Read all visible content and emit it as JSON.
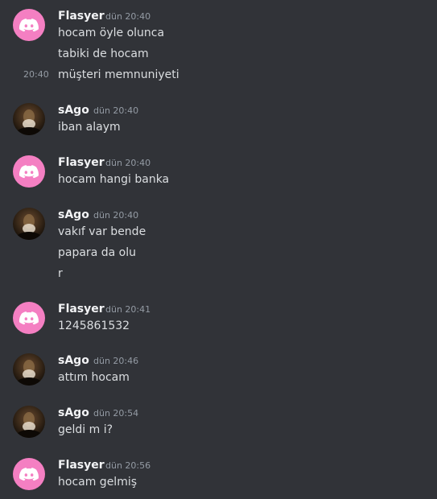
{
  "messages": [
    {
      "author": "Flasyer",
      "time": "dün 20:40",
      "lines": [
        "hocam öyle olunca",
        "tabiki de hocam",
        "müşteri memnuniyeti"
      ],
      "side_time": "20:40"
    },
    {
      "author": "sAgo",
      "time": "dün 20:40",
      "lines": [
        "iban alaym"
      ]
    },
    {
      "author": "Flasyer",
      "time": "dün 20:40",
      "lines": [
        "hocam hangi banka"
      ]
    },
    {
      "author": "sAgo",
      "time": "dün 20:40",
      "lines": [
        "vakıf var bende",
        "papara da olu",
        "r"
      ]
    },
    {
      "author": "Flasyer",
      "time": "dün 20:41",
      "lines": [
        "1245861532"
      ]
    },
    {
      "author": "sAgo",
      "time": "dün 20:46",
      "lines": [
        "attım hocam"
      ]
    },
    {
      "author": "sAgo",
      "time": "dün 20:54",
      "lines": [
        "geldi m i?"
      ]
    },
    {
      "author": "Flasyer",
      "time": "dün 20:56",
      "lines": [
        "hocam gelmiş"
      ]
    }
  ],
  "colors": {
    "background": "#313338",
    "discord_avatar": "#f47fc2"
  }
}
